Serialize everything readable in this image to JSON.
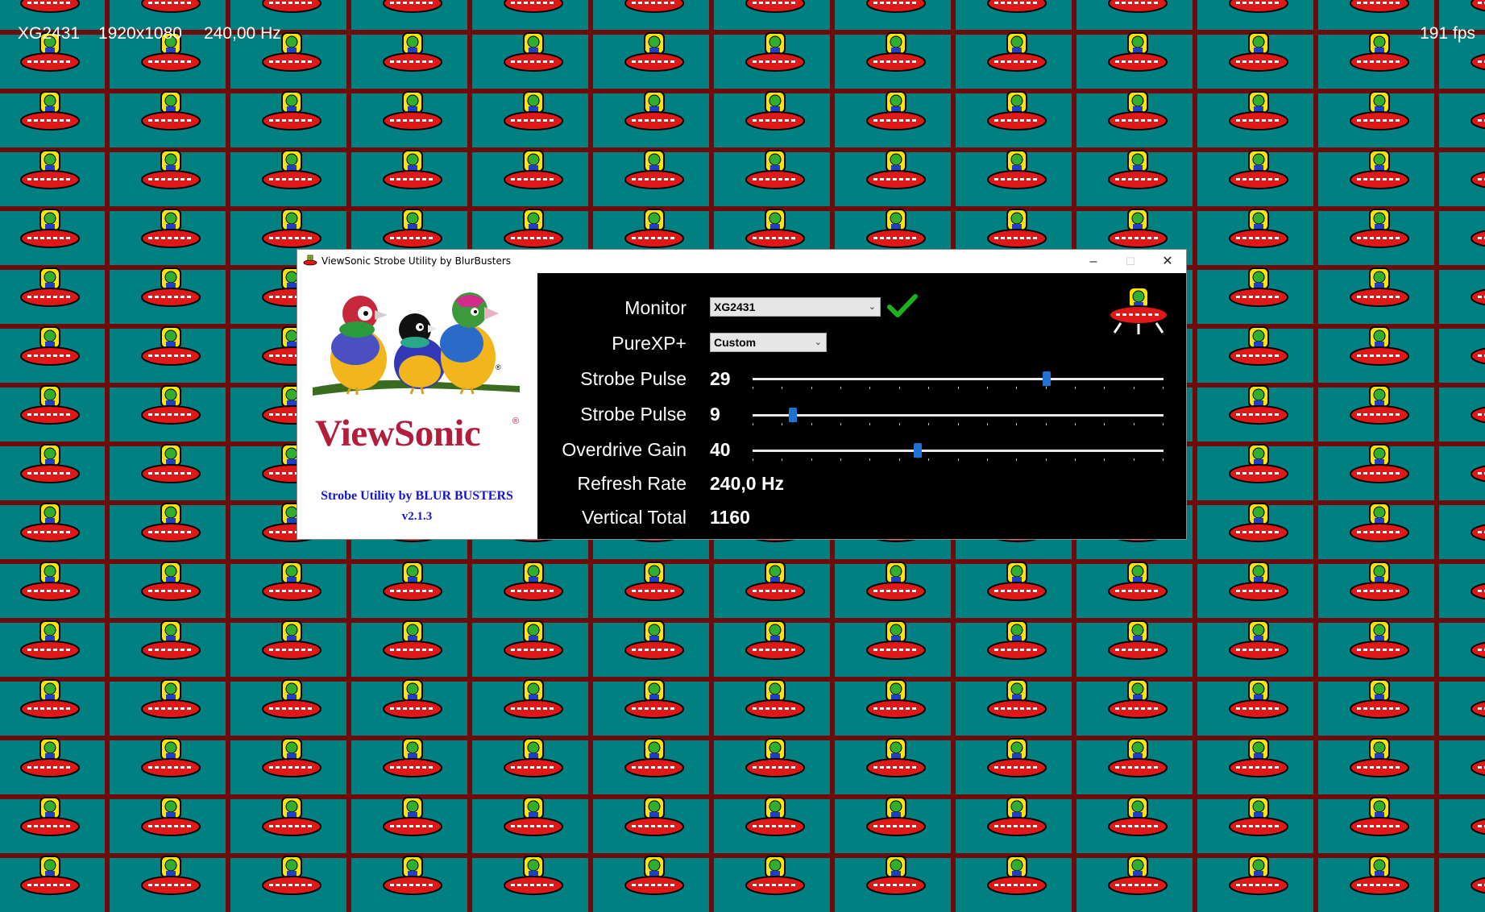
{
  "hud": {
    "monitor": "XG2431",
    "resolution": "1920x1080",
    "refresh": "240,00 Hz",
    "fps": "191 fps"
  },
  "colors": {
    "tile": "#008080",
    "grid": "#6f0b0b",
    "accent": "#1e73d2",
    "brand": "#b01e3c",
    "credit": "#1414d8"
  },
  "window": {
    "title": "ViewSonic Strobe Utility by BlurBusters",
    "app_icon": "ufo-icon",
    "minimize": "–",
    "maximize": "☐",
    "close": "✕"
  },
  "left": {
    "brand": "ViewSonic",
    "registered": "®",
    "credit_line1": "Strobe Utility by BLUR  BUSTERS",
    "credit_line2": "v2.1.3"
  },
  "settings": {
    "monitor_label": "Monitor",
    "monitor_value": "XG2431",
    "purexp_label": "PureXP+",
    "purexp_value": "Custom",
    "strobe_pulse_label": "Strobe Pulse",
    "strobe_pulse_value": "29",
    "strobe_phase_label": "Strobe Pulse",
    "strobe_phase_value": "9",
    "overdrive_label": "Overdrive Gain",
    "overdrive_value": "40",
    "refresh_label": "Refresh Rate",
    "refresh_value": "240,0 Hz",
    "vtotal_label": "Vertical Total",
    "vtotal_value": "1160",
    "status_icon": "checkmark-icon",
    "logo_icon": "ufo-icon"
  },
  "sliders": {
    "strobe_pulse_fraction": 0.72,
    "strobe_phase_fraction": 0.09,
    "overdrive_fraction": 0.4
  }
}
